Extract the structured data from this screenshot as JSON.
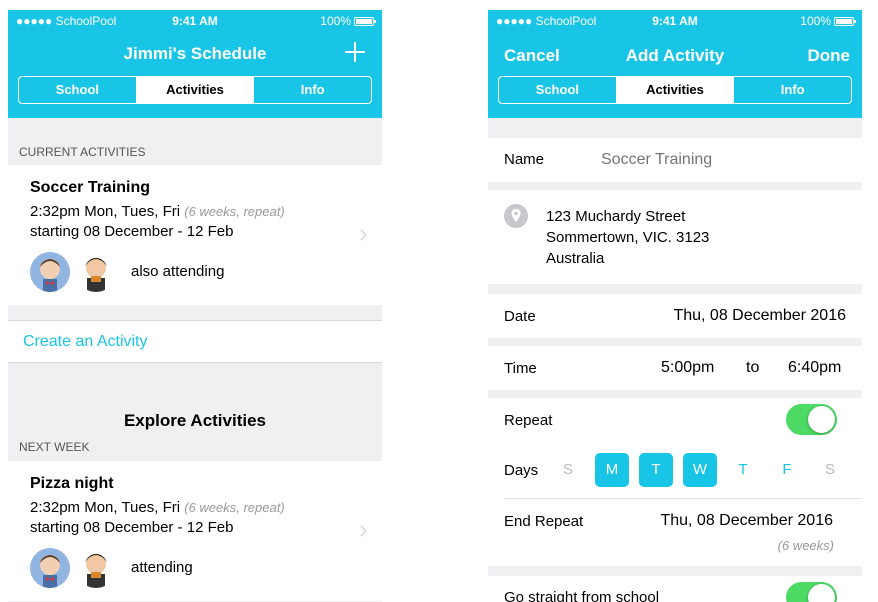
{
  "status_bar": {
    "carrier": "●●●●● SchoolPool",
    "time": "9:41 AM",
    "battery": "100%",
    "wifi_icon": "wifi-icon",
    "battery_icon": "battery-icon"
  },
  "left_screen": {
    "title": "Jimmi's Schedule",
    "add_icon": "plus-icon",
    "tabs": [
      {
        "label": "School"
      },
      {
        "label": "Activities",
        "active": true
      },
      {
        "label": "Info"
      }
    ],
    "current_section": "CURRENT ACTIVITIES",
    "current_activity": {
      "title": "Soccer Training",
      "schedule": "2:32pm Mon, Tues, Fri",
      "note": "(6 weeks, repeat)",
      "dates": "starting 08 December - 12 Feb",
      "attendance": "also attending"
    },
    "create_link": "Create an Activity",
    "explore_title": "Explore Activities",
    "next_week_section": "NEXT WEEK",
    "next_activity": {
      "title": "Pizza night",
      "schedule": "2:32pm Mon, Tues, Fri",
      "note": "(6 weeks, repeat)",
      "dates": "starting 08 December - 12 Feb",
      "attendance": "attending"
    }
  },
  "right_screen": {
    "cancel": "Cancel",
    "title": "Add Activity",
    "done": "Done",
    "tabs": [
      {
        "label": "School"
      },
      {
        "label": "Activities",
        "active": true
      },
      {
        "label": "Info"
      }
    ],
    "name": {
      "label": "Name",
      "placeholder": "Soccer Training"
    },
    "address": {
      "line1": "123 Muchardy Street",
      "line2": "Sommertown, VIC. 3123",
      "line3": "Australia",
      "icon": "location-pin-icon"
    },
    "date": {
      "label": "Date",
      "value": "Thu, 08 December 2016"
    },
    "time": {
      "label": "Time",
      "start": "5:00pm",
      "separator": "to",
      "end": "6:40pm"
    },
    "repeat": {
      "label": "Repeat",
      "on": true
    },
    "days": {
      "label": "Days",
      "items": [
        {
          "letter": "S",
          "selected": false
        },
        {
          "letter": "M",
          "selected": true
        },
        {
          "letter": "T",
          "selected": true
        },
        {
          "letter": "W",
          "selected": true
        },
        {
          "letter": "T",
          "selected": false
        },
        {
          "letter": "F",
          "selected": false
        },
        {
          "letter": "S",
          "selected": false
        }
      ]
    },
    "end_repeat": {
      "label": "End Repeat",
      "value": "Thu, 08 December 2016",
      "note": "(6 weeks)"
    },
    "straight_from_school": {
      "label": "Go straight from school",
      "on": true
    }
  },
  "colors": {
    "accent": "#19c5e6",
    "toggle_on": "#4cd964",
    "background": "#f0f0f3"
  }
}
